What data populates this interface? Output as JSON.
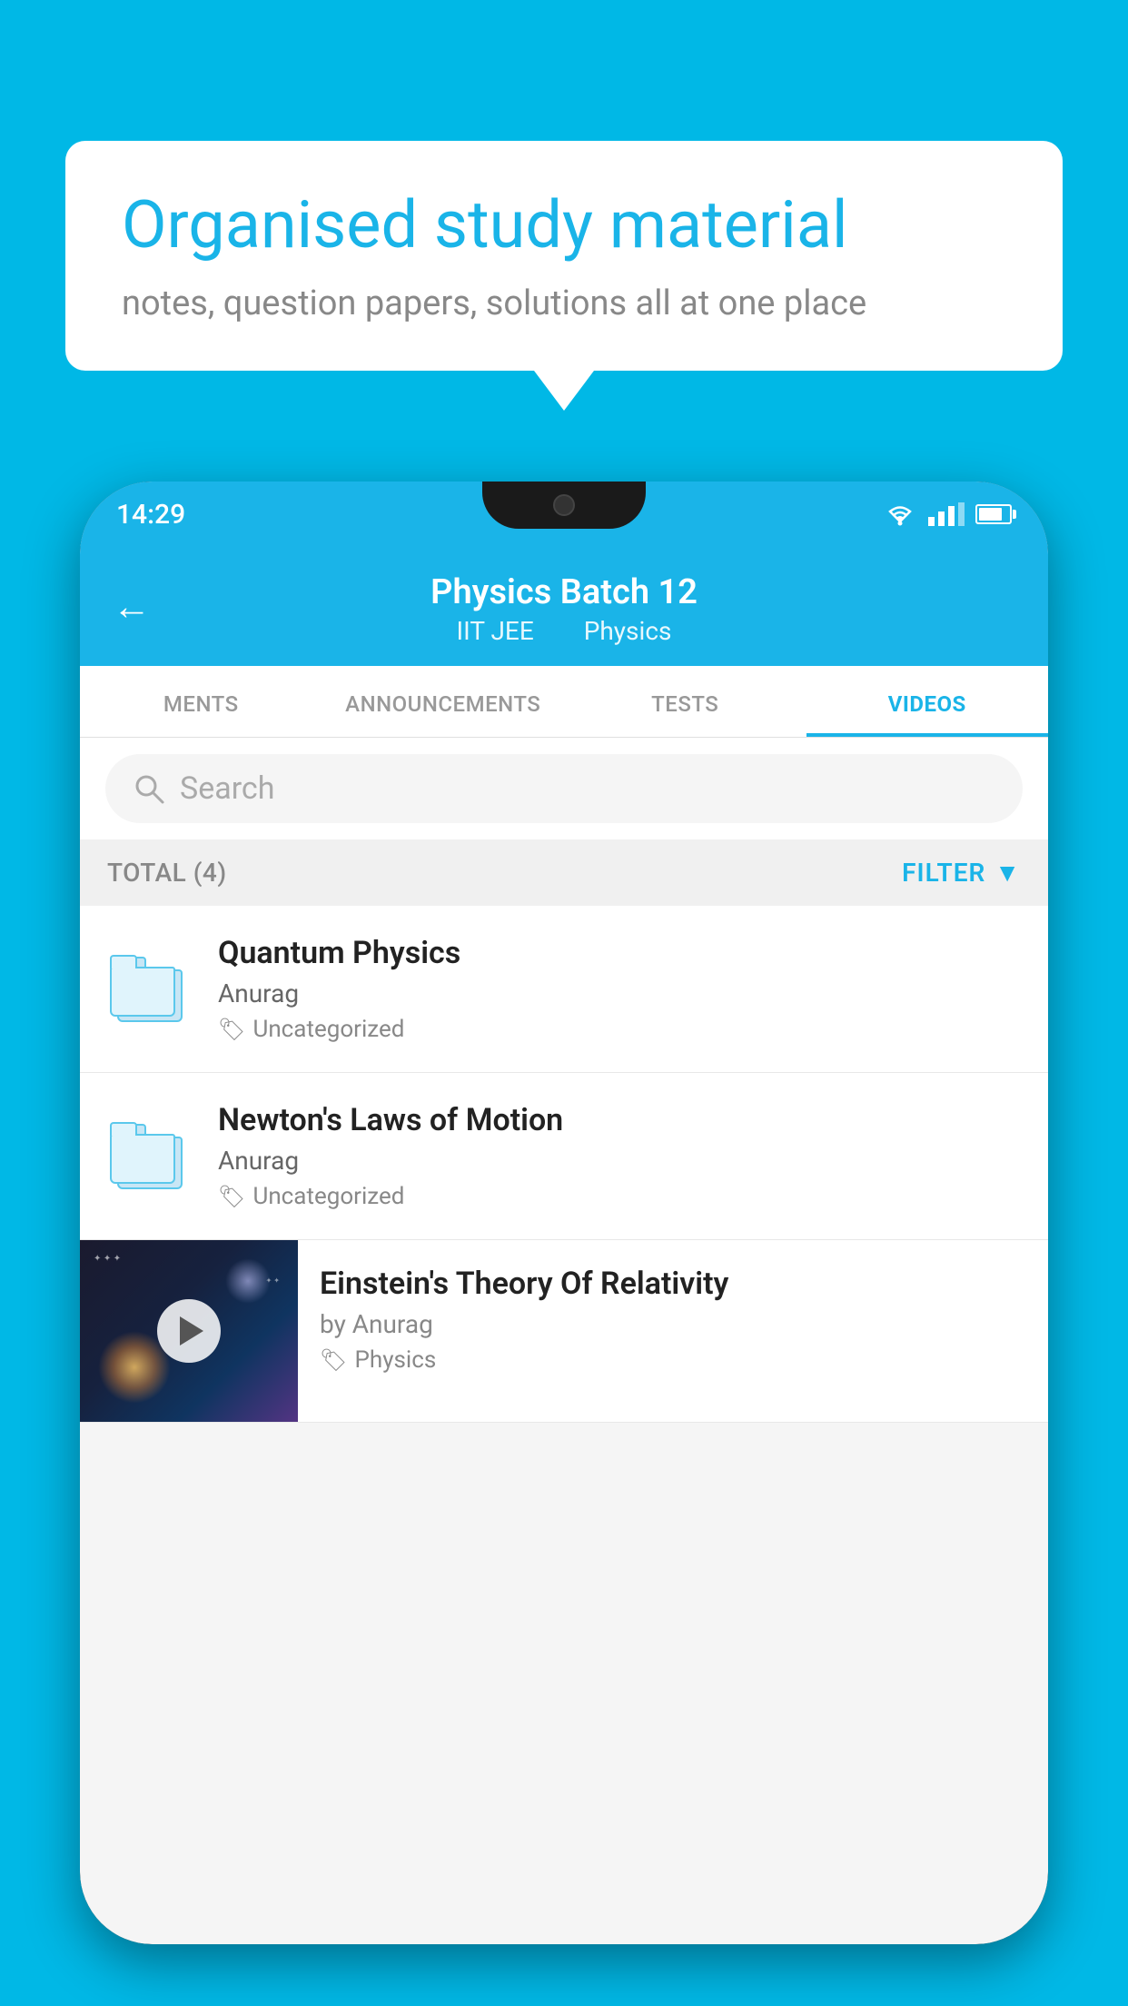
{
  "background_color": "#00b8e6",
  "speech_bubble": {
    "title": "Organised study material",
    "subtitle": "notes, question papers, solutions all at one place"
  },
  "phone": {
    "status_bar": {
      "time": "14:29"
    },
    "header": {
      "back_label": "←",
      "title": "Physics Batch 12",
      "subtitle_part1": "IIT JEE",
      "subtitle_part2": "Physics"
    },
    "tabs": [
      {
        "label": "MENTS",
        "active": false
      },
      {
        "label": "ANNOUNCEMENTS",
        "active": false
      },
      {
        "label": "TESTS",
        "active": false
      },
      {
        "label": "VIDEOS",
        "active": true
      }
    ],
    "search": {
      "placeholder": "Search"
    },
    "filter_bar": {
      "total_label": "TOTAL (4)",
      "filter_label": "FILTER"
    },
    "videos": [
      {
        "id": 1,
        "title": "Quantum Physics",
        "author": "Anurag",
        "tag": "Uncategorized",
        "has_thumbnail": false
      },
      {
        "id": 2,
        "title": "Newton's Laws of Motion",
        "author": "Anurag",
        "tag": "Uncategorized",
        "has_thumbnail": false
      },
      {
        "id": 3,
        "title": "Einstein's Theory Of Relativity",
        "author": "by Anurag",
        "tag": "Physics",
        "has_thumbnail": true
      }
    ]
  }
}
